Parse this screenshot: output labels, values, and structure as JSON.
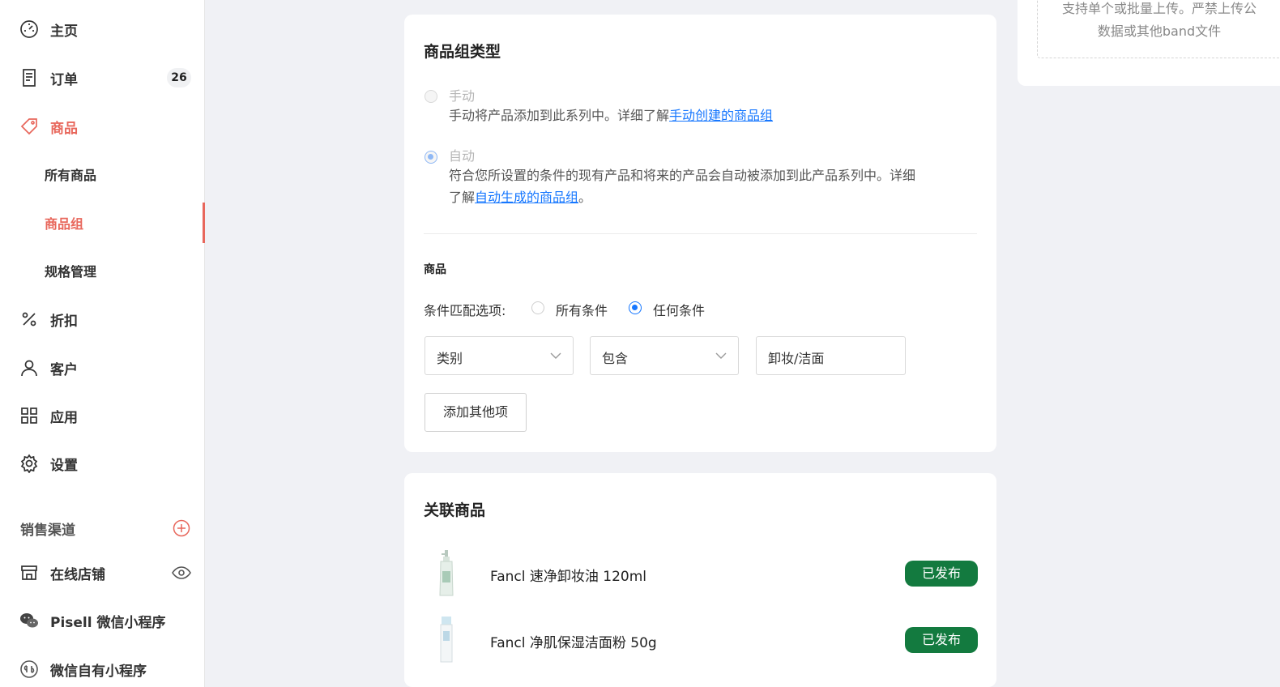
{
  "sidebar": {
    "items": [
      {
        "label": "主页",
        "icon": "dashboard-icon"
      },
      {
        "label": "订单",
        "icon": "receipt-icon",
        "badge": "26"
      },
      {
        "label": "商品",
        "icon": "tag-icon"
      },
      {
        "label": "折扣",
        "icon": "percent-icon"
      },
      {
        "label": "客户",
        "icon": "user-icon"
      },
      {
        "label": "应用",
        "icon": "apps-grid-icon"
      },
      {
        "label": "设置",
        "icon": "gear-icon"
      }
    ],
    "sub_items": [
      {
        "label": "所有商品"
      },
      {
        "label": "商品组"
      },
      {
        "label": "规格管理"
      }
    ],
    "channels_label": "销售渠道",
    "channels": [
      {
        "label": "在线店铺",
        "icon": "store-icon"
      },
      {
        "label": "Pisell 微信小程序",
        "icon": "wechat-icon"
      },
      {
        "label": "微信自有小程序",
        "icon": "mini-program-icon"
      }
    ],
    "accent": "#e8675c"
  },
  "group_type": {
    "title": "商品组类型",
    "manual": {
      "label": "手动",
      "desc": "手动将产品添加到此系列中。详细了解",
      "link": "手动创建的商品组"
    },
    "auto": {
      "label": "自动",
      "desc_line1": "符合您所设置的条件的现有产品和将来的产品会自动被添加到此产品系列中。详细",
      "desc_line2_prefix": "了解",
      "link": "自动生成的商品组",
      "desc_suffix": "。"
    },
    "products_title": "商品",
    "match_label": "条件匹配选项:",
    "match_all": "所有条件",
    "match_any": "任何条件",
    "condition": {
      "field": "类别",
      "operator": "包含",
      "value": "卸妆/洁面"
    },
    "add_button": "添加其他项"
  },
  "related": {
    "title": "关联商品",
    "products": [
      {
        "name": "Fancl 速净卸妆油 120ml",
        "status": "已发布"
      },
      {
        "name": "Fancl 净肌保湿洁面粉 50g",
        "status": "已发布"
      }
    ],
    "status_color": "#137a3f"
  },
  "upload": {
    "line1": "支持单个或批量上传。严禁上传公",
    "line2": "数据或其他band文件"
  }
}
